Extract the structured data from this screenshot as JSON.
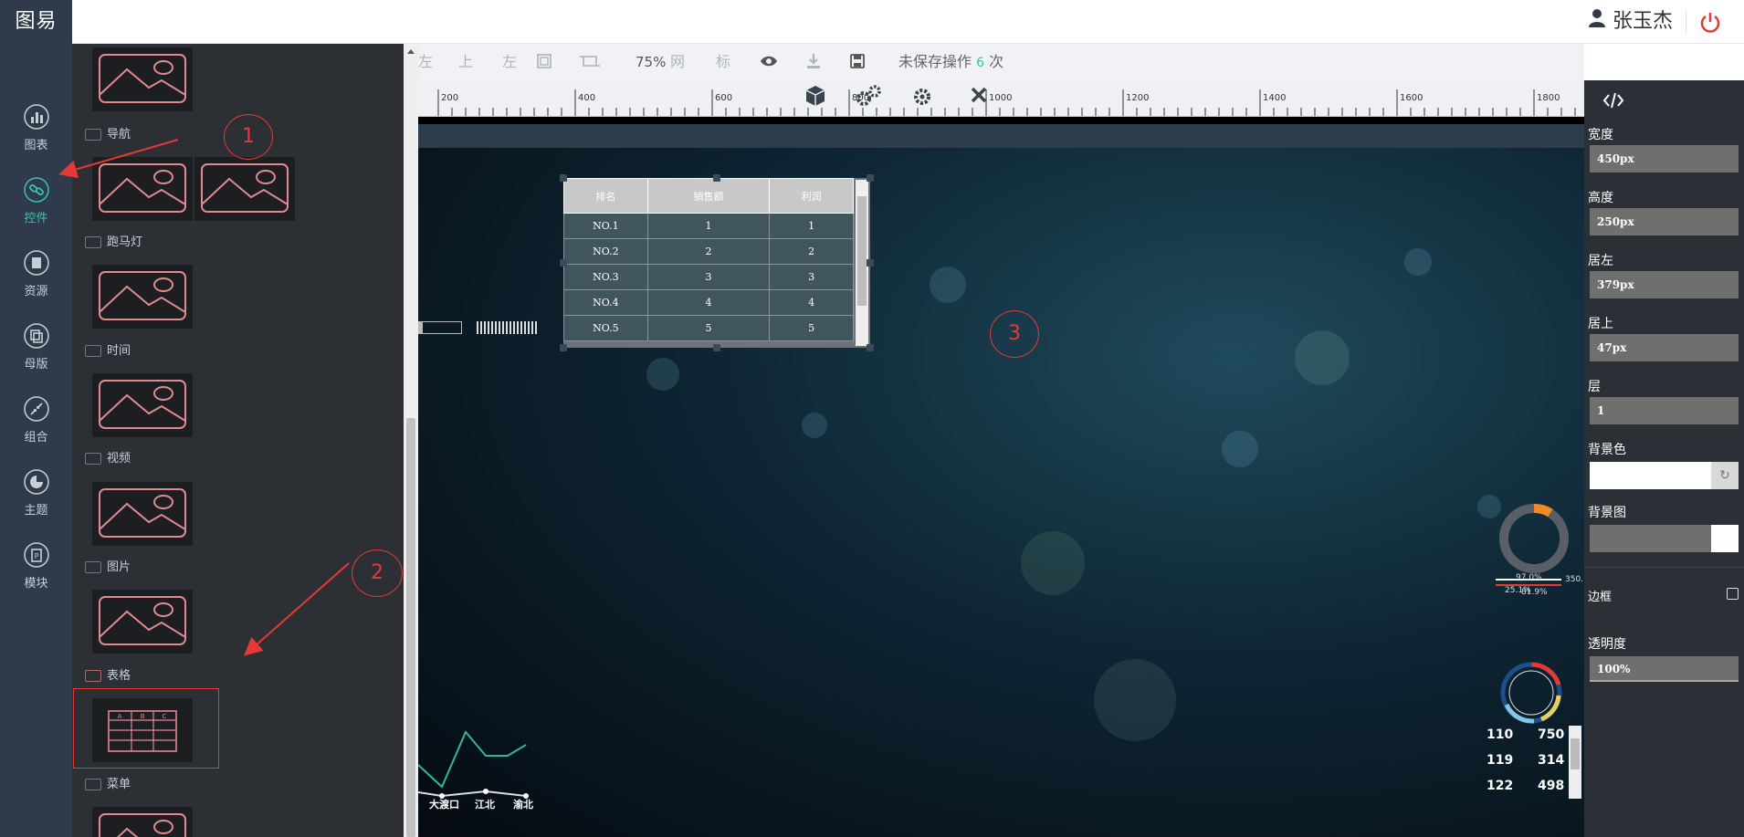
{
  "app": {
    "logo_text": "图易",
    "user_name": "张玉杰"
  },
  "nav": {
    "items": [
      {
        "label": "图表",
        "icon": "bar-chart-icon"
      },
      {
        "label": "控件",
        "icon": "link-icon",
        "active": true
      },
      {
        "label": "资源",
        "icon": "book-icon"
      },
      {
        "label": "母版",
        "icon": "copy-icon"
      },
      {
        "label": "组合",
        "icon": "compress-icon"
      },
      {
        "label": "主题",
        "icon": "pie-icon"
      },
      {
        "label": "模块",
        "icon": "document-icon"
      }
    ]
  },
  "palette": {
    "items": [
      {
        "label": "导航"
      },
      {
        "label": "跑马灯"
      },
      {
        "label": "时间"
      },
      {
        "label": "视频"
      },
      {
        "label": "图片"
      },
      {
        "label": "表格"
      },
      {
        "label": "菜单"
      }
    ]
  },
  "toolbar": {
    "align_right": "左",
    "align_top": "上",
    "align_left": "左",
    "zoom": "75%",
    "grid": "网",
    "ruler": "标",
    "unsaved_label": "未保存操作",
    "unsaved_count": "6",
    "unsaved_suffix": "次"
  },
  "ruler": {
    "labels": [
      "200",
      "400",
      "600",
      "800",
      "1000",
      "1200",
      "1400",
      "1600",
      "1800"
    ]
  },
  "table_widget": {
    "headers": [
      "排名",
      "销售额",
      "利润"
    ],
    "rows": [
      [
        "NO.1",
        "1",
        "1"
      ],
      [
        "NO.2",
        "2",
        "2"
      ],
      [
        "NO.3",
        "3",
        "3"
      ],
      [
        "NO.4",
        "4",
        "4"
      ],
      [
        "NO.5",
        "5",
        "5"
      ]
    ]
  },
  "props": {
    "width_label": "宽度",
    "width_value": "450px",
    "height_label": "高度",
    "height_value": "250px",
    "left_label": "居左",
    "left_value": "379px",
    "top_label": "居上",
    "top_value": "47px",
    "layer_label": "层",
    "layer_value": "1",
    "bgcolor_label": "背景色",
    "bgimage_label": "背景图",
    "border_label": "边框",
    "opacity_label": "透明度",
    "opacity_value": "100%"
  },
  "canvas_widgets": {
    "ring_top_pct": "97.0%",
    "ring_top_value": "350.",
    "ring_top_sub": "25.1%",
    "ring_top_sub2": "81.9%",
    "numbers": [
      [
        "110",
        "750"
      ],
      [
        "119",
        "314"
      ],
      [
        "122",
        "498"
      ]
    ],
    "line_labels": [
      "大渡口",
      "江北",
      "渝北"
    ]
  },
  "annotations": [
    "1",
    "2",
    "3"
  ],
  "colors": {
    "accent": "#35c4b0",
    "annotation": "#e53935",
    "thumb_stroke": "#e08a8f",
    "power": "#e53935"
  }
}
